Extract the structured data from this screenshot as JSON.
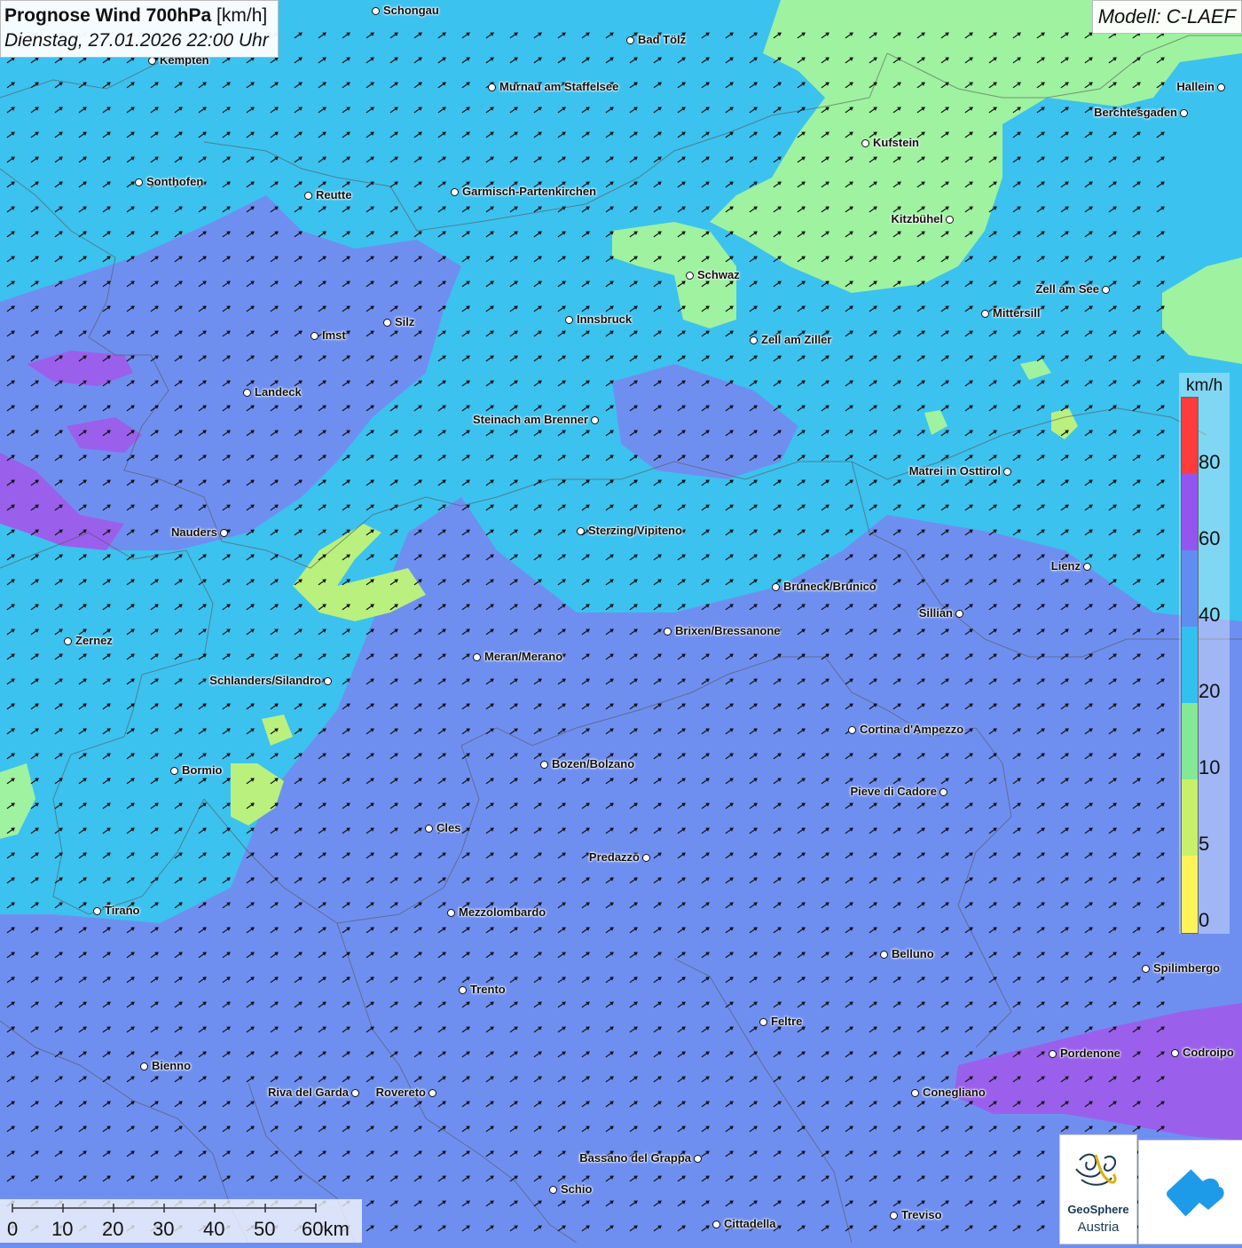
{
  "title": {
    "main": "Prognose Wind 700hPa",
    "unit": "[km/h]",
    "datetime": "Dienstag, 27.01.2026 22:00 Uhr"
  },
  "model": "Modell: C-LAEF",
  "legend": {
    "unit": "km/h",
    "labels": [
      "80",
      "60",
      "40",
      "20",
      "10",
      "5",
      "0"
    ],
    "colors": [
      "#ff3b3b",
      "#9455ee",
      "#5f8ef0",
      "#33c0ee",
      "#84e896",
      "#c9f06a",
      "#fff35a"
    ]
  },
  "scale": {
    "labels": [
      "0",
      "10",
      "20",
      "30",
      "40",
      "50",
      "60km"
    ]
  },
  "logo": {
    "name1": "GeoSphere",
    "name2": "Austria"
  },
  "colors": {
    "base": "#6f8ff0",
    "cyan": "#3cc2ef",
    "green": "#9ff2a0",
    "purple": "#9a60ec"
  },
  "wind_arrow_icon": "arrow-northeast-icon",
  "cities": [
    {
      "name": "Schongau"
    },
    {
      "name": "Bad Tölz"
    },
    {
      "name": "Kempten"
    },
    {
      "name": "Murnau am Staffelsee"
    },
    {
      "name": "Hallein"
    },
    {
      "name": "Berchtesgaden"
    },
    {
      "name": "Kufstein"
    },
    {
      "name": "Sonthofen"
    },
    {
      "name": "Reutte"
    },
    {
      "name": "Garmisch-Partenkirchen"
    },
    {
      "name": "Kitzbühel"
    },
    {
      "name": "Schwaz"
    },
    {
      "name": "Zell am See"
    },
    {
      "name": "Mittersill"
    },
    {
      "name": "Innsbruck"
    },
    {
      "name": "Imst"
    },
    {
      "name": "Silz"
    },
    {
      "name": "Zell am Ziller"
    },
    {
      "name": "Landeck"
    },
    {
      "name": "Steinach am Brenner"
    },
    {
      "name": "Matrei in Osttirol"
    },
    {
      "name": "Nauders"
    },
    {
      "name": "Sterzing/Vipiteno"
    },
    {
      "name": "Lienz"
    },
    {
      "name": "Bruneck/Brunico"
    },
    {
      "name": "Sillian"
    },
    {
      "name": "Zernez"
    },
    {
      "name": "Brixen/Bressanone"
    },
    {
      "name": "Meran/Merano"
    },
    {
      "name": "Schlanders/Silandro"
    },
    {
      "name": "Cortina d'Ampezzo"
    },
    {
      "name": "Bozen/Bolzano"
    },
    {
      "name": "Bormio"
    },
    {
      "name": "Pieve di Cadore"
    },
    {
      "name": "Cles"
    },
    {
      "name": "Predazzo"
    },
    {
      "name": "Tirano"
    },
    {
      "name": "Mezzolombardo"
    },
    {
      "name": "Belluno"
    },
    {
      "name": "Spilimbergo"
    },
    {
      "name": "Trento"
    },
    {
      "name": "Feltre"
    },
    {
      "name": "Pordenone"
    },
    {
      "name": "Codroipo"
    },
    {
      "name": "Bienno"
    },
    {
      "name": "Riva del Garda"
    },
    {
      "name": "Rovereto"
    },
    {
      "name": "Conegliano"
    },
    {
      "name": "Bassano del Grappa"
    },
    {
      "name": "Schio"
    },
    {
      "name": "Treviso"
    },
    {
      "name": "Cittadella"
    }
  ]
}
